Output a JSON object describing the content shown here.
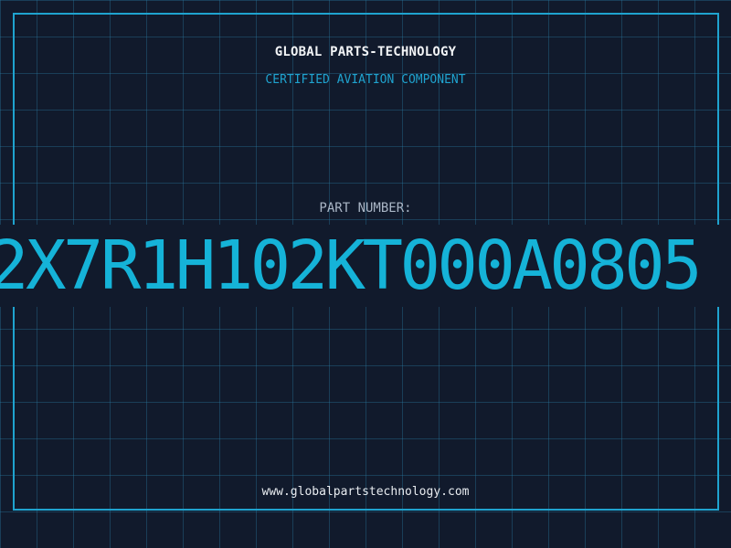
{
  "header": {
    "company": "GLOBAL PARTS-TECHNOLOGY",
    "subtitle": "CERTIFIED AVIATION COMPONENT"
  },
  "part": {
    "label": "PART NUMBER:",
    "value": "2X7R1H102KT000A0805"
  },
  "footer": {
    "url": "www.globalpartstechnology.com"
  },
  "colors": {
    "background": "#111a2c",
    "accent": "#1fa3cf",
    "part_number": "#15b3d8",
    "grid": "#28789f"
  }
}
